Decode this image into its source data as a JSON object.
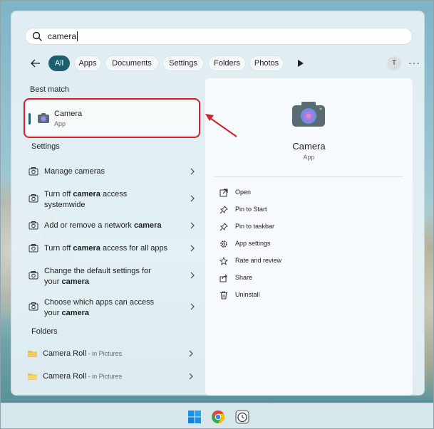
{
  "search": {
    "value": "camera",
    "icon": "search-icon"
  },
  "filters": {
    "back_icon": "arrow-left-icon",
    "chips": [
      "All",
      "Apps",
      "Documents",
      "Settings",
      "Folders",
      "Photos"
    ],
    "active": "All",
    "avatar_letter": "T",
    "more_icon": "ellipsis-icon"
  },
  "best_match": {
    "title": "Best match",
    "name": "Camera",
    "type": "App",
    "icon": "camera-app-icon"
  },
  "settings": {
    "title": "Settings",
    "items": [
      {
        "pre": "Manage cameras",
        "bold": "",
        "post": "",
        "line2": ""
      },
      {
        "pre": "Turn off ",
        "bold": "camera",
        "post": " access",
        "line2": "systemwide"
      },
      {
        "pre": "Add or remove a network ",
        "bold": "camera",
        "post": "",
        "line2": ""
      },
      {
        "pre": "Turn off ",
        "bold": "camera",
        "post": " access for all apps",
        "line2": ""
      },
      {
        "pre": "Change the default settings for",
        "bold": "",
        "post": "",
        "line2_pre": "your ",
        "line2_bold": "camera"
      },
      {
        "pre": "Choose which apps can access",
        "bold": "",
        "post": "",
        "line2_pre": "your ",
        "line2_bold": "camera"
      }
    ]
  },
  "folders": {
    "title": "Folders",
    "items": [
      {
        "name": "Camera Roll",
        "location": " - in Pictures"
      },
      {
        "name": "Camera Roll",
        "location": " - in Pictures"
      }
    ]
  },
  "detail": {
    "name": "Camera",
    "type": "App",
    "actions": [
      {
        "label": "Open",
        "icon": "open-external-icon"
      },
      {
        "label": "Pin to Start",
        "icon": "pin-icon"
      },
      {
        "label": "Pin to taskbar",
        "icon": "pin-icon"
      },
      {
        "label": "App settings",
        "icon": "gear-icon"
      },
      {
        "label": "Rate and review",
        "icon": "star-icon"
      },
      {
        "label": "Share",
        "icon": "share-icon"
      },
      {
        "label": "Uninstall",
        "icon": "trash-icon"
      }
    ]
  },
  "colors": {
    "accent": "#1d5e6f",
    "highlight": "#d4202a"
  },
  "taskbar": {
    "icons": [
      "windows-start-icon",
      "chrome-icon",
      "clock-app-icon"
    ]
  }
}
